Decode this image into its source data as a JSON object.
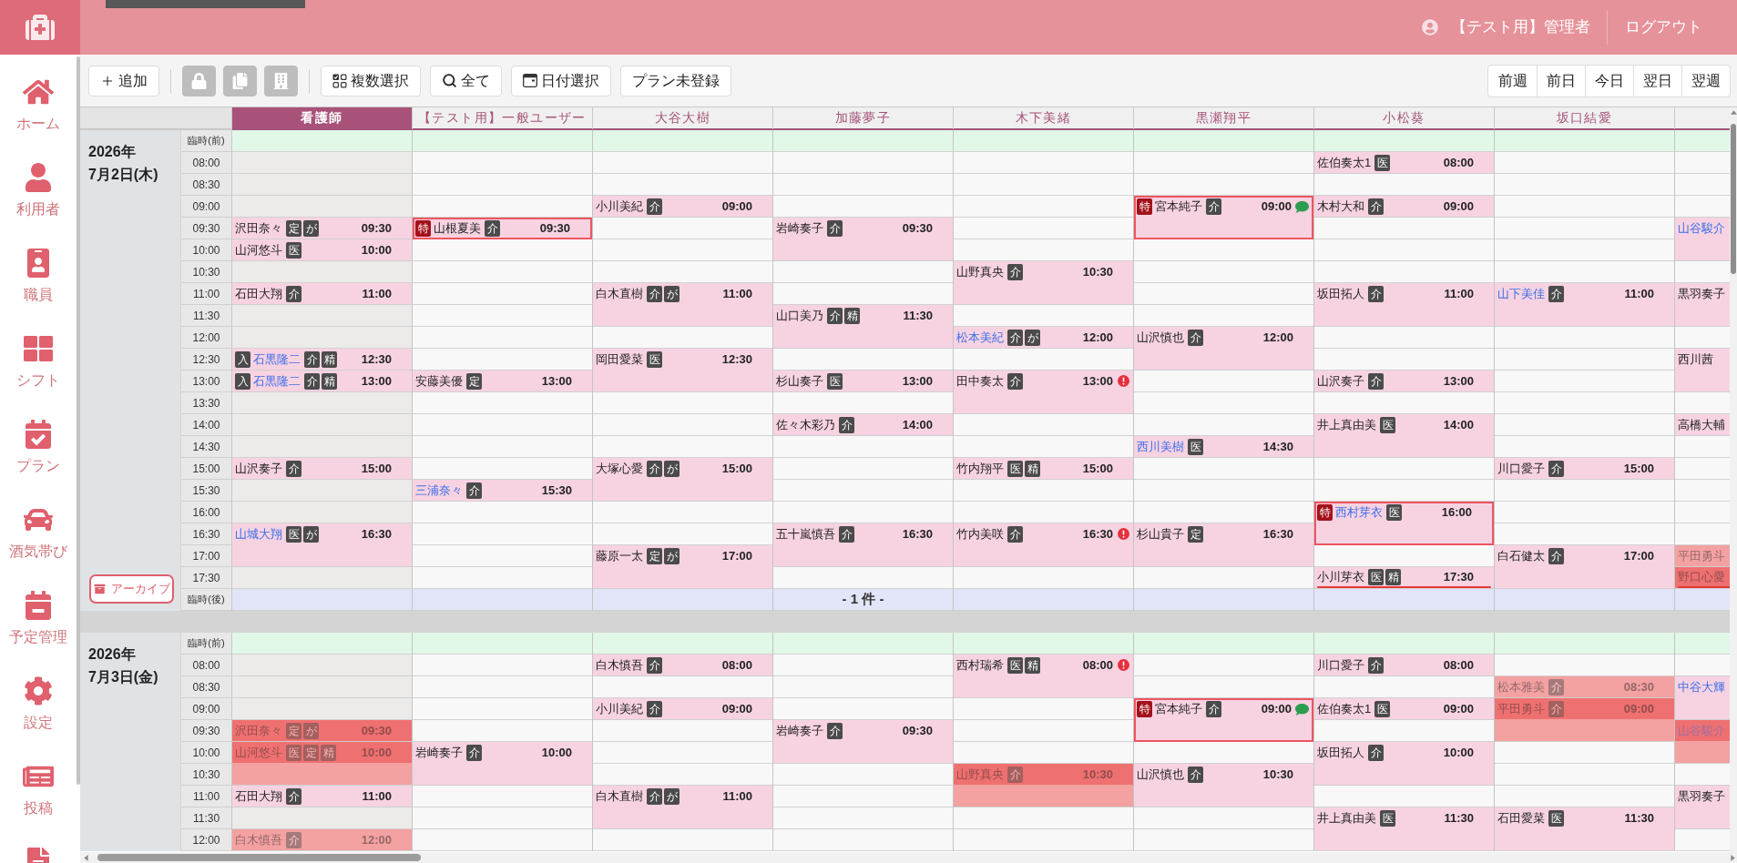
{
  "header": {
    "user": "【テスト用】管理者",
    "logout": "ログアウト"
  },
  "sidebar": {
    "items": [
      "ホーム",
      "利用者",
      "職員",
      "シフト",
      "プラン",
      "酒気帯び",
      "予定管理",
      "設定",
      "投稿"
    ]
  },
  "toolbar": {
    "groups": [
      [
        {
          "kind": "text",
          "label": "追加"
        }
      ],
      [
        {
          "kind": "icon",
          "disabled": true
        },
        {
          "kind": "icon",
          "disabled": true
        },
        {
          "kind": "icon",
          "disabled": true
        }
      ],
      [
        {
          "kind": "text",
          "label": "複数選択"
        },
        {
          "kind": "text",
          "label": "全て"
        },
        {
          "kind": "text",
          "label": "日付選択"
        },
        {
          "kind": "text",
          "label": "プラン未登録"
        }
      ]
    ],
    "nav": [
      "前週",
      "前日",
      "今日",
      "翌日",
      "翌週"
    ]
  },
  "schedule": {
    "columns": [
      {
        "name": "看護師",
        "selected": true
      },
      {
        "name": "【テスト用】一般ユーザー",
        "selected": false
      },
      {
        "name": "大谷大樹",
        "selected": false
      },
      {
        "name": "加藤夢子",
        "selected": false
      },
      {
        "name": "木下美緒",
        "selected": false
      },
      {
        "name": "黒瀬翔平",
        "selected": false
      },
      {
        "name": "小松葵",
        "selected": false
      },
      {
        "name": "坂口結愛",
        "selected": false
      },
      {
        "selected": false
      }
    ],
    "days": [
      {
        "year": "2026年",
        "date": "7月2日(木)",
        "archive": "アーカイブ",
        "slots": [
          {
            "label": "臨時(前)",
            "kind": "before"
          },
          {
            "label": "08:00",
            "kind": "time"
          },
          {
            "label": "08:30",
            "kind": "time"
          },
          {
            "label": "09:00",
            "kind": "time"
          },
          {
            "label": "09:30",
            "kind": "time"
          },
          {
            "label": "10:00",
            "kind": "time"
          },
          {
            "label": "10:30",
            "kind": "time"
          },
          {
            "label": "11:00",
            "kind": "time"
          },
          {
            "label": "11:30",
            "kind": "time"
          },
          {
            "label": "12:00",
            "kind": "time"
          },
          {
            "label": "12:30",
            "kind": "time"
          },
          {
            "label": "13:00",
            "kind": "time"
          },
          {
            "label": "13:30",
            "kind": "time"
          },
          {
            "label": "14:00",
            "kind": "time"
          },
          {
            "label": "14:30",
            "kind": "time"
          },
          {
            "label": "15:00",
            "kind": "time"
          },
          {
            "label": "15:30",
            "kind": "time"
          },
          {
            "label": "16:00",
            "kind": "time"
          },
          {
            "label": "16:30",
            "kind": "time"
          },
          {
            "label": "17:00",
            "kind": "time"
          },
          {
            "label": "17:30",
            "kind": "time"
          },
          {
            "label": "臨時(後)",
            "kind": "after"
          }
        ],
        "columns": [
          {
            "cells": [
              {
                "kind": "free"
              },
              {
                "kind": "free"
              },
              {
                "kind": "free"
              },
              {
                "kind": "free"
              },
              {
                "kind": "visit",
                "name": "沢田奈々",
                "link": false,
                "tags": [
                  "定",
                  "が"
                ],
                "time": "09:30",
                "long": false,
                "conflict": false,
                "dimmed": false
              },
              {
                "kind": "visit",
                "name": "山河悠斗",
                "link": false,
                "tags": [
                  "医"
                ],
                "time": "10:00",
                "long": false,
                "conflict": false,
                "dimmed": false
              },
              {
                "kind": "free"
              },
              {
                "kind": "visit",
                "name": "石田大翔",
                "link": false,
                "tags": [
                  "介"
                ],
                "time": "11:00",
                "long": false,
                "conflict": false,
                "dimmed": false
              },
              {
                "kind": "free"
              },
              {
                "kind": "free"
              },
              {
                "kind": "visit",
                "name": "石黒隆二",
                "link": true,
                "prefix": {
                  "text": "入",
                  "kind": "plain"
                },
                "tags": [
                  "介",
                  "精"
                ],
                "time": "12:30",
                "long": false,
                "conflict": false,
                "dimmed": false
              },
              {
                "kind": "visit",
                "name": "石黒隆二",
                "link": true,
                "prefix": {
                  "text": "入",
                  "kind": "plain"
                },
                "tags": [
                  "介",
                  "精"
                ],
                "time": "13:00",
                "long": false,
                "conflict": false,
                "dimmed": false
              },
              {
                "kind": "free"
              },
              {
                "kind": "free"
              },
              {
                "kind": "free"
              },
              {
                "kind": "visit",
                "name": "山沢奏子",
                "link": false,
                "tags": [
                  "介"
                ],
                "time": "15:00",
                "long": false,
                "conflict": false,
                "dimmed": false
              },
              {
                "kind": "free"
              },
              {
                "kind": "free"
              },
              {
                "kind": "visit",
                "name": "山城大翔",
                "link": true,
                "tags": [
                  "医",
                  "が"
                ],
                "time": "16:30",
                "long": true,
                "conflict": false,
                "dimmed": false
              }
            ]
          },
          {
            "cells": [
              {
                "kind": "free"
              },
              {
                "kind": "free"
              },
              {
                "kind": "free"
              },
              {
                "kind": "free"
              },
              {
                "kind": "visit",
                "name": "山根夏美",
                "link": false,
                "prefix": {
                  "text": "特",
                  "kind": "special"
                },
                "tags": [
                  "介"
                ],
                "time": "09:30",
                "long": false,
                "conflict": false,
                "dimmed": false
              },
              {
                "kind": "free"
              },
              {
                "kind": "free"
              },
              {
                "kind": "free"
              },
              {
                "kind": "free"
              },
              {
                "kind": "free"
              },
              {
                "kind": "free"
              },
              {
                "kind": "visit",
                "name": "安藤美優",
                "link": false,
                "tags": [
                  "定"
                ],
                "time": "13:00",
                "long": false,
                "conflict": false,
                "dimmed": false
              },
              {
                "kind": "free"
              },
              {
                "kind": "free"
              },
              {
                "kind": "free"
              },
              {
                "kind": "free"
              },
              {
                "kind": "visit",
                "name": "三浦奈々",
                "link": true,
                "tags": [
                  "介"
                ],
                "time": "15:30",
                "long": false,
                "conflict": false,
                "dimmed": false
              }
            ]
          },
          {
            "cells": [
              {
                "kind": "free"
              },
              {
                "kind": "free"
              },
              {
                "kind": "free"
              },
              {
                "kind": "visit",
                "name": "小川美紀",
                "link": false,
                "tags": [
                  "介"
                ],
                "time": "09:00",
                "long": false,
                "conflict": false,
                "dimmed": false
              },
              {
                "kind": "free"
              },
              {
                "kind": "free"
              },
              {
                "kind": "free"
              },
              {
                "kind": "visit",
                "name": "白木直樹",
                "link": false,
                "tags": [
                  "介",
                  "が"
                ],
                "time": "11:00",
                "long": true,
                "conflict": false,
                "dimmed": false
              },
              {
                "kind": "free"
              },
              {
                "kind": "visit",
                "name": "岡田愛菜",
                "link": false,
                "tags": [
                  "医"
                ],
                "time": "12:30",
                "long": true,
                "conflict": false,
                "dimmed": false
              },
              {
                "kind": "free"
              },
              {
                "kind": "free"
              },
              {
                "kind": "free"
              },
              {
                "kind": "visit",
                "name": "大塚心愛",
                "link": false,
                "tags": [
                  "介",
                  "が"
                ],
                "time": "15:00",
                "long": true,
                "conflict": false,
                "dimmed": false
              },
              {
                "kind": "free"
              },
              {
                "kind": "free"
              },
              {
                "kind": "visit",
                "name": "藤原一太",
                "link": false,
                "tags": [
                  "定",
                  "が"
                ],
                "time": "17:00",
                "long": true,
                "conflict": false,
                "dimmed": false
              }
            ]
          },
          {
            "cells": [
              {
                "kind": "free"
              },
              {
                "kind": "free"
              },
              {
                "kind": "free"
              },
              {
                "kind": "free"
              },
              {
                "kind": "visit",
                "name": "岩崎奏子",
                "link": false,
                "tags": [
                  "介"
                ],
                "time": "09:30",
                "long": true,
                "conflict": false,
                "dimmed": false
              },
              {
                "kind": "free"
              },
              {
                "kind": "free"
              },
              {
                "kind": "visit",
                "name": "山口美乃",
                "link": false,
                "tags": [
                  "介",
                  "精"
                ],
                "time": "11:30",
                "long": true,
                "conflict": false,
                "dimmed": false
              },
              {
                "kind": "free"
              },
              {
                "kind": "visit",
                "name": "杉山奏子",
                "link": false,
                "tags": [
                  "医"
                ],
                "time": "13:00",
                "long": false,
                "conflict": false,
                "dimmed": false
              },
              {
                "kind": "free"
              },
              {
                "kind": "visit",
                "name": "佐々木彩乃",
                "link": false,
                "tags": [
                  "介"
                ],
                "time": "14:00",
                "long": false,
                "conflict": false,
                "dimmed": false
              },
              {
                "kind": "free"
              },
              {
                "kind": "free"
              },
              {
                "kind": "free"
              },
              {
                "kind": "free"
              },
              {
                "kind": "visit",
                "name": "五十嵐慎吾",
                "link": false,
                "tags": [
                  "介"
                ],
                "time": "16:30",
                "long": true,
                "conflict": false,
                "dimmed": false
              },
              {
                "kind": "free"
              },
              {
                "kind": "note",
                "text": "- 1 件 -"
              }
            ]
          },
          {
            "cells": [
              {
                "kind": "free"
              },
              {
                "kind": "free"
              },
              {
                "kind": "free"
              },
              {
                "kind": "free"
              },
              {
                "kind": "free"
              },
              {
                "kind": "free"
              },
              {
                "kind": "visit",
                "name": "山野真央",
                "link": false,
                "tags": [
                  "介"
                ],
                "time": "10:30",
                "long": true,
                "conflict": false,
                "dimmed": false
              },
              {
                "kind": "free"
              },
              {
                "kind": "visit",
                "name": "松本美紀",
                "link": true,
                "tags": [
                  "介",
                  "が"
                ],
                "time": "12:00",
                "long": false,
                "conflict": false,
                "dimmed": false
              },
              {
                "kind": "free"
              },
              {
                "kind": "visit",
                "name": "田中奏太",
                "link": false,
                "tags": [
                  "介"
                ],
                "time": "13:00",
                "long": true,
                "conflict": false,
                "dimmed": false,
                "alert": true
              },
              {
                "kind": "free"
              },
              {
                "kind": "free"
              },
              {
                "kind": "visit",
                "name": "竹内翔平",
                "link": false,
                "tags": [
                  "医",
                  "精"
                ],
                "time": "15:00",
                "long": false,
                "conflict": false,
                "dimmed": false
              },
              {
                "kind": "free"
              },
              {
                "kind": "free"
              },
              {
                "kind": "visit",
                "name": "竹内美咲",
                "link": false,
                "tags": [
                  "介"
                ],
                "time": "16:30",
                "long": true,
                "conflict": false,
                "dimmed": false,
                "alert": true
              }
            ]
          },
          {
            "cells": [
              {
                "kind": "free"
              },
              {
                "kind": "free"
              },
              {
                "kind": "free"
              },
              {
                "kind": "visit",
                "name": "宮本純子",
                "link": false,
                "prefix": {
                  "text": "特",
                  "kind": "special"
                },
                "tags": [
                  "介"
                ],
                "time": "09:00",
                "long": true,
                "conflict": false,
                "dimmed": false,
                "comment": true
              },
              {
                "kind": "free"
              },
              {
                "kind": "free"
              },
              {
                "kind": "free"
              },
              {
                "kind": "free"
              },
              {
                "kind": "visit",
                "name": "山沢慎也",
                "link": false,
                "tags": [
                  "介"
                ],
                "time": "12:00",
                "long": true,
                "conflict": false,
                "dimmed": false
              },
              {
                "kind": "free"
              },
              {
                "kind": "free"
              },
              {
                "kind": "free"
              },
              {
                "kind": "visit",
                "name": "西川美樹",
                "link": true,
                "tags": [
                  "医"
                ],
                "time": "14:30",
                "long": false,
                "conflict": false,
                "dimmed": false
              },
              {
                "kind": "free"
              },
              {
                "kind": "free"
              },
              {
                "kind": "free"
              },
              {
                "kind": "visit",
                "name": "杉山貴子",
                "link": false,
                "tags": [
                  "定"
                ],
                "time": "16:30",
                "long": true,
                "conflict": false,
                "dimmed": false
              }
            ]
          },
          {
            "cells": [
              {
                "kind": "free"
              },
              {
                "kind": "visit",
                "name": "佐伯奏太1",
                "link": false,
                "tags": [
                  "医"
                ],
                "time": "08:00",
                "long": false,
                "conflict": false,
                "dimmed": false
              },
              {
                "kind": "free"
              },
              {
                "kind": "visit",
                "name": "木村大和",
                "link": false,
                "tags": [
                  "介"
                ],
                "time": "09:00",
                "long": false,
                "conflict": false,
                "dimmed": false
              },
              {
                "kind": "free"
              },
              {
                "kind": "free"
              },
              {
                "kind": "free"
              },
              {
                "kind": "visit",
                "name": "坂田拓人",
                "link": false,
                "tags": [
                  "介"
                ],
                "time": "11:00",
                "long": true,
                "conflict": false,
                "dimmed": false
              },
              {
                "kind": "free"
              },
              {
                "kind": "free"
              },
              {
                "kind": "visit",
                "name": "山沢奏子",
                "link": false,
                "tags": [
                  "介"
                ],
                "time": "13:00",
                "long": false,
                "conflict": false,
                "dimmed": false
              },
              {
                "kind": "free"
              },
              {
                "kind": "visit",
                "name": "井上真由美",
                "link": false,
                "tags": [
                  "医"
                ],
                "time": "14:00",
                "long": true,
                "conflict": false,
                "dimmed": false
              },
              {
                "kind": "free"
              },
              {
                "kind": "free"
              },
              {
                "kind": "visit",
                "name": "西村芽衣",
                "link": true,
                "prefix": {
                  "text": "特",
                  "kind": "special"
                },
                "tags": [
                  "医"
                ],
                "time": "16:00",
                "long": true,
                "conflict": false,
                "dimmed": false
              },
              {
                "kind": "free"
              },
              {
                "kind": "visit",
                "name": "小川芽衣",
                "link": false,
                "tags": [
                  "医",
                  "精"
                ],
                "time": "17:30",
                "long": false,
                "conflict": false,
                "dimmed": false,
                "overflow": true
              }
            ]
          },
          {
            "cells": [
              {
                "kind": "free"
              },
              {
                "kind": "free"
              },
              {
                "kind": "free"
              },
              {
                "kind": "free"
              },
              {
                "kind": "free"
              },
              {
                "kind": "free"
              },
              {
                "kind": "free"
              },
              {
                "kind": "visit",
                "name": "山下美佳",
                "link": true,
                "tags": [
                  "介"
                ],
                "time": "11:00",
                "long": true,
                "conflict": false,
                "dimmed": false
              },
              {
                "kind": "free"
              },
              {
                "kind": "free"
              },
              {
                "kind": "free"
              },
              {
                "kind": "free"
              },
              {
                "kind": "free"
              },
              {
                "kind": "free"
              },
              {
                "kind": "visit",
                "name": "川口愛子",
                "link": false,
                "tags": [
                  "介"
                ],
                "time": "15:00",
                "long": false,
                "conflict": false,
                "dimmed": false
              },
              {
                "kind": "free"
              },
              {
                "kind": "free"
              },
              {
                "kind": "free"
              },
              {
                "kind": "visit",
                "name": "白石健太",
                "link": false,
                "tags": [
                  "介"
                ],
                "time": "17:00",
                "long": true,
                "conflict": false,
                "dimmed": false
              }
            ]
          },
          {
            "cells": [
              {
                "kind": "free"
              },
              {
                "kind": "free"
              },
              {
                "kind": "free"
              },
              {
                "kind": "free"
              },
              {
                "kind": "visit",
                "name": "山谷駿介",
                "link": true,
                "long": true,
                "conflict": false,
                "dimmed": false
              },
              {
                "kind": "free"
              },
              {
                "kind": "visit",
                "name": "黒羽奏子",
                "link": false,
                "long": true,
                "conflict": false,
                "dimmed": false
              },
              {
                "kind": "free"
              },
              {
                "kind": "visit",
                "name": "西川茜",
                "link": false,
                "long": true,
                "conflict": false,
                "dimmed": false
              },
              {
                "kind": "free"
              },
              {
                "kind": "visit",
                "name": "高橋大輔",
                "link": false,
                "long": false,
                "conflict": false,
                "dimmed": false
              },
              {
                "kind": "free"
              },
              {
                "kind": "free"
              },
              {
                "kind": "free"
              },
              {
                "kind": "free"
              },
              {
                "kind": "free"
              },
              {
                "kind": "visit",
                "name": "平田勇斗",
                "link": false,
                "long": false,
                "conflict": false,
                "dimmed": true
              },
              {
                "kind": "visit",
                "name": "野口心愛",
                "link": false,
                "long": false,
                "conflict": true,
                "dimmed": false,
                "overflow": true
              }
            ]
          }
        ]
      },
      {
        "year": "2026年",
        "date": "7月3日(金)",
        "slots": [
          {
            "label": "臨時(前)",
            "kind": "before"
          },
          {
            "label": "08:00",
            "kind": "time"
          },
          {
            "label": "08:30",
            "kind": "time"
          },
          {
            "label": "09:00",
            "kind": "time"
          },
          {
            "label": "09:30",
            "kind": "time"
          },
          {
            "label": "10:00",
            "kind": "time"
          },
          {
            "label": "10:30",
            "kind": "time"
          },
          {
            "label": "11:00",
            "kind": "time"
          },
          {
            "label": "11:30",
            "kind": "time"
          },
          {
            "label": "12:00",
            "kind": "time"
          }
        ],
        "columns": [
          {
            "cells": [
              {
                "kind": "free"
              },
              {
                "kind": "free"
              },
              {
                "kind": "free"
              },
              {
                "kind": "free"
              },
              {
                "kind": "visit",
                "name": "沢田奈々",
                "link": false,
                "tags": [
                  "定",
                  "が"
                ],
                "time": "09:30",
                "long": false,
                "conflict": true,
                "dimmed": false
              },
              {
                "kind": "visit",
                "name": "山河悠斗",
                "link": false,
                "tags": [
                  "医",
                  "定",
                  "精"
                ],
                "time": "10:00",
                "long": true,
                "conflict": true,
                "dimmed": false
              },
              {
                "kind": "visit",
                "name": "石田大翔",
                "link": false,
                "tags": [
                  "介"
                ],
                "time": "11:00",
                "long": false,
                "conflict": false,
                "dimmed": false
              },
              {
                "kind": "free"
              },
              {
                "kind": "visit",
                "name": "白木慎吾",
                "link": false,
                "tags": [
                  "介"
                ],
                "time": "12:00",
                "long": false,
                "conflict": false,
                "dimmed": true
              }
            ]
          },
          {
            "cells": [
              {
                "kind": "free"
              },
              {
                "kind": "free"
              },
              {
                "kind": "free"
              },
              {
                "kind": "free"
              },
              {
                "kind": "free"
              },
              {
                "kind": "visit",
                "name": "岩崎奏子",
                "link": false,
                "tags": [
                  "介"
                ],
                "time": "10:00",
                "long": true,
                "conflict": false,
                "dimmed": false
              }
            ]
          },
          {
            "cells": [
              {
                "kind": "free"
              },
              {
                "kind": "visit",
                "name": "白木慎吾",
                "link": false,
                "tags": [
                  "介"
                ],
                "time": "08:00",
                "long": false,
                "conflict": false,
                "dimmed": false
              },
              {
                "kind": "free"
              },
              {
                "kind": "visit",
                "name": "小川美紀",
                "link": false,
                "tags": [
                  "介"
                ],
                "time": "09:00",
                "long": false,
                "conflict": false,
                "dimmed": false
              },
              {
                "kind": "free"
              },
              {
                "kind": "free"
              },
              {
                "kind": "free"
              },
              {
                "kind": "visit",
                "name": "白木直樹",
                "link": false,
                "tags": [
                  "介",
                  "が"
                ],
                "time": "11:00",
                "long": true,
                "conflict": false,
                "dimmed": false
              }
            ]
          },
          {
            "cells": [
              {
                "kind": "free"
              },
              {
                "kind": "free"
              },
              {
                "kind": "free"
              },
              {
                "kind": "free"
              },
              {
                "kind": "visit",
                "name": "岩崎奏子",
                "link": false,
                "tags": [
                  "介"
                ],
                "time": "09:30",
                "long": true,
                "conflict": false,
                "dimmed": false
              }
            ]
          },
          {
            "cells": [
              {
                "kind": "free"
              },
              {
                "kind": "visit",
                "name": "西村瑞希",
                "link": false,
                "tags": [
                  "医",
                  "精"
                ],
                "time": "08:00",
                "long": true,
                "conflict": false,
                "dimmed": false,
                "alert": true
              },
              {
                "kind": "free"
              },
              {
                "kind": "free"
              },
              {
                "kind": "free"
              },
              {
                "kind": "visit",
                "name": "山野真央",
                "link": false,
                "tags": [
                  "介"
                ],
                "time": "10:30",
                "long": true,
                "conflict": true,
                "dimmed": false
              }
            ]
          },
          {
            "cells": [
              {
                "kind": "free"
              },
              {
                "kind": "free"
              },
              {
                "kind": "free"
              },
              {
                "kind": "visit",
                "name": "宮本純子",
                "link": false,
                "prefix": {
                  "text": "特",
                  "kind": "special"
                },
                "tags": [
                  "介"
                ],
                "time": "09:00",
                "long": true,
                "conflict": false,
                "dimmed": false,
                "comment": true
              },
              {
                "kind": "free"
              },
              {
                "kind": "visit",
                "name": "山沢慎也",
                "link": false,
                "tags": [
                  "介"
                ],
                "time": "10:30",
                "long": true,
                "conflict": false,
                "dimmed": false
              }
            ]
          },
          {
            "cells": [
              {
                "kind": "free"
              },
              {
                "kind": "visit",
                "name": "川口愛子",
                "link": false,
                "tags": [
                  "介"
                ],
                "time": "08:00",
                "long": false,
                "conflict": false,
                "dimmed": false
              },
              {
                "kind": "free"
              },
              {
                "kind": "visit",
                "name": "佐伯奏太1",
                "link": false,
                "tags": [
                  "医"
                ],
                "time": "09:00",
                "long": false,
                "conflict": false,
                "dimmed": false
              },
              {
                "kind": "free"
              },
              {
                "kind": "visit",
                "name": "坂田拓人",
                "link": false,
                "tags": [
                  "介"
                ],
                "time": "10:00",
                "long": true,
                "conflict": false,
                "dimmed": false
              },
              {
                "kind": "free"
              },
              {
                "kind": "visit",
                "name": "井上真由美",
                "link": false,
                "tags": [
                  "医"
                ],
                "time": "11:30",
                "long": true,
                "conflict": false,
                "dimmed": false
              }
            ]
          },
          {
            "cells": [
              {
                "kind": "free"
              },
              {
                "kind": "free"
              },
              {
                "kind": "visit",
                "name": "松本雅美",
                "link": false,
                "tags": [
                  "介"
                ],
                "time": "08:30",
                "long": false,
                "conflict": false,
                "dimmed": true
              },
              {
                "kind": "visit",
                "name": "平田勇斗",
                "link": false,
                "tags": [
                  "介"
                ],
                "time": "09:00",
                "long": true,
                "conflict": true,
                "dimmed": false
              },
              {
                "kind": "free"
              },
              {
                "kind": "free"
              },
              {
                "kind": "free"
              },
              {
                "kind": "visit",
                "name": "石田愛菜",
                "link": false,
                "tags": [
                  "医"
                ],
                "time": "11:30",
                "long": true,
                "conflict": false,
                "dimmed": false
              }
            ]
          },
          {
            "cells": [
              {
                "kind": "free"
              },
              {
                "kind": "free"
              },
              {
                "kind": "visit",
                "name": "中谷大輝",
                "link": true,
                "long": true,
                "conflict": false,
                "dimmed": false
              },
              {
                "kind": "visit",
                "name": "山谷駿介",
                "link": true,
                "long": true,
                "conflict": true,
                "dimmed": false
              },
              {
                "kind": "free"
              },
              {
                "kind": "visit",
                "name": "黒羽奏子",
                "link": false,
                "long": true,
                "conflict": false,
                "dimmed": false
              }
            ]
          }
        ]
      }
    ]
  }
}
